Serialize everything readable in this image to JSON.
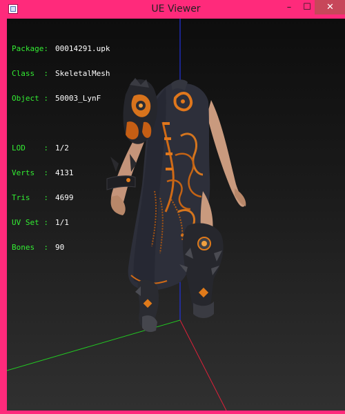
{
  "window": {
    "title": "UE Viewer",
    "buttons": {
      "minimize": "–",
      "maximize": "☐",
      "close": "✕"
    }
  },
  "info": {
    "package": {
      "label": "Package:",
      "value": "00014291.upk"
    },
    "class": {
      "label": "Class  :",
      "value": "SkeletalMesh"
    },
    "object": {
      "label": "Object :",
      "value": "50003_LynF"
    },
    "lod": {
      "label": "LOD    :",
      "value": "1/2"
    },
    "verts": {
      "label": "Verts  :",
      "value": "4131"
    },
    "tris": {
      "label": "Tris   :",
      "value": "4699"
    },
    "uvset": {
      "label": "UV Set :",
      "value": "1/1"
    },
    "bones": {
      "label": "Bones  :",
      "value": "90"
    }
  },
  "colors": {
    "titlebar": "#ff2a7b",
    "info_label": "#33ee33",
    "info_value": "#ffffff",
    "axis_x": "#e0203a",
    "axis_y": "#22cc22",
    "axis_z": "#2233dd"
  }
}
